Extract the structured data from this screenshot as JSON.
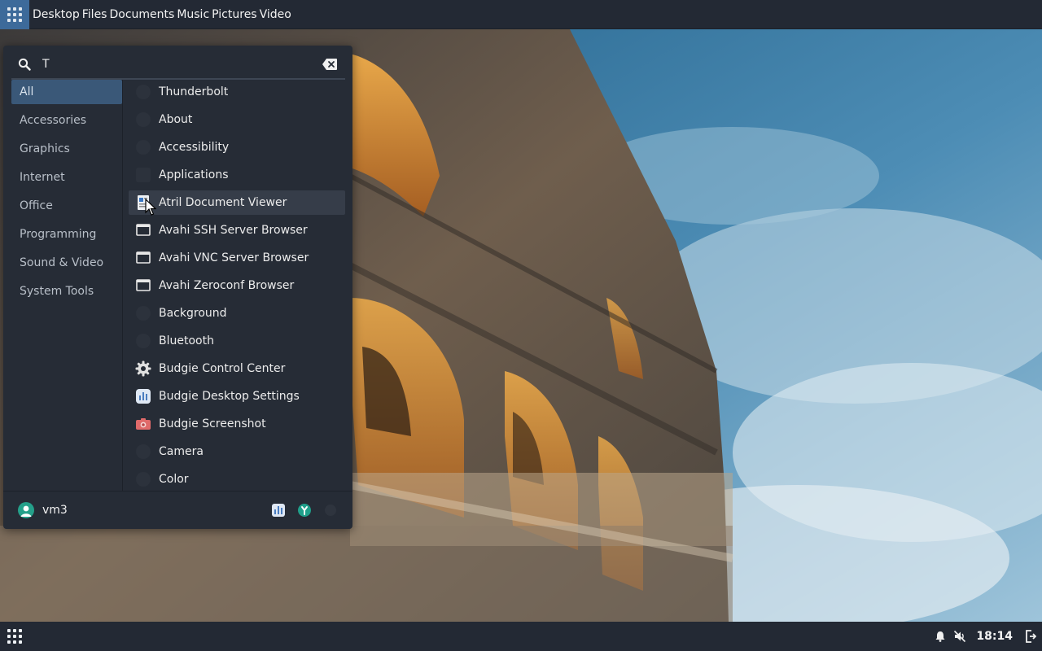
{
  "top_panel": {
    "places": [
      "Desktop",
      "Files",
      "Documents",
      "Music",
      "Pictures",
      "Video"
    ]
  },
  "menu": {
    "search": {
      "value": "T",
      "placeholder": ""
    },
    "categories": [
      {
        "label": "All",
        "active": true
      },
      {
        "label": "Accessories"
      },
      {
        "label": "Graphics"
      },
      {
        "label": "Internet"
      },
      {
        "label": "Office"
      },
      {
        "label": "Programming"
      },
      {
        "label": "Sound & Video"
      },
      {
        "label": "System Tools"
      }
    ],
    "apps": [
      {
        "label": "Thunderbolt",
        "icon": "thunderbolt-icon"
      },
      {
        "label": "About",
        "icon": "about-icon"
      },
      {
        "label": "Accessibility",
        "icon": "accessibility-icon"
      },
      {
        "label": "Applications",
        "icon": "applications-icon"
      },
      {
        "label": "Atril Document Viewer",
        "icon": "document-viewer-icon",
        "hovered": true
      },
      {
        "label": "Avahi SSH Server Browser",
        "icon": "network-browser-icon"
      },
      {
        "label": "Avahi VNC Server Browser",
        "icon": "network-browser-icon"
      },
      {
        "label": "Avahi Zeroconf Browser",
        "icon": "network-browser-icon"
      },
      {
        "label": "Background",
        "icon": "background-icon"
      },
      {
        "label": "Bluetooth",
        "icon": "bluetooth-icon"
      },
      {
        "label": "Budgie Control Center",
        "icon": "gear-icon"
      },
      {
        "label": "Budgie Desktop Settings",
        "icon": "desktop-settings-icon"
      },
      {
        "label": "Budgie Screenshot",
        "icon": "camera-screenshot-icon"
      },
      {
        "label": "Camera",
        "icon": "camera-icon"
      },
      {
        "label": "Color",
        "icon": "color-icon"
      }
    ],
    "footer": {
      "user_name": "vm3",
      "actions": [
        "desktop-settings-icon",
        "control-center-icon",
        "power-icon"
      ]
    }
  },
  "bottom_panel": {
    "clock": "18:14",
    "tray": [
      "notification-bell-icon",
      "muted-speaker-icon",
      "logout-icon"
    ]
  },
  "colors": {
    "panel": "#232934",
    "menu_bg": "#262c36",
    "active_category": "#3a5878",
    "launcher_accent": "#3d6a9a",
    "user_avatar": "#24a08a"
  }
}
